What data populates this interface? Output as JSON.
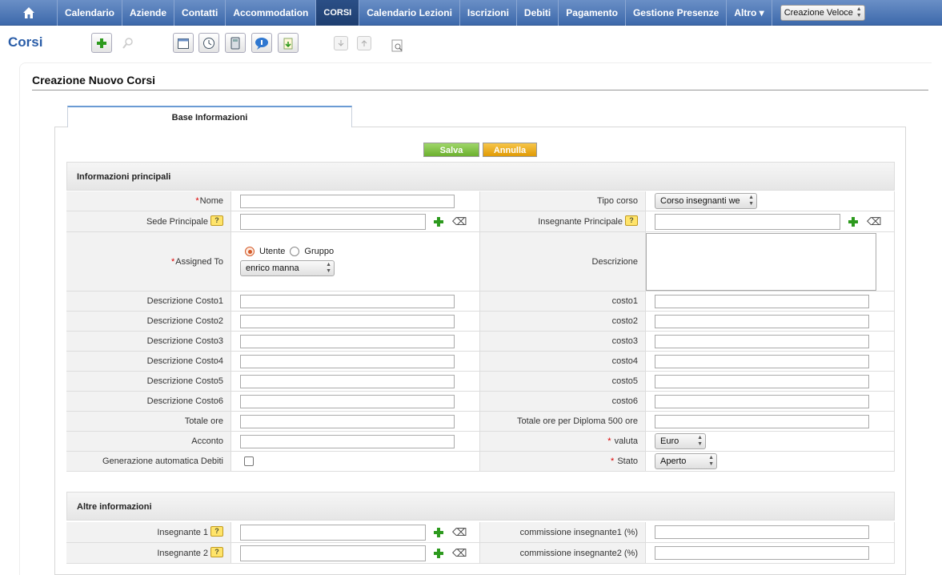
{
  "nav": {
    "items": [
      "Calendario",
      "Aziende",
      "Contatti",
      "Accommodation",
      "CORSI",
      "Calendario Lezioni",
      "Iscrizioni",
      "Debiti",
      "Pagamento",
      "Gestione Presenze",
      "Altro ▾"
    ],
    "active": "CORSI",
    "quick_create": "Creazione Veloce"
  },
  "module_title": "Corsi",
  "icons": {
    "add": "add-icon",
    "search": "search-icon",
    "calendar": "calendar-icon",
    "clock": "clock-icon",
    "calculator": "calculator-icon",
    "chat": "chat-icon",
    "note": "note-icon",
    "import": "import-icon",
    "export": "export-icon",
    "find-duplicates": "find-duplicates-icon"
  },
  "page_title": "Creazione Nuovo Corsi",
  "tab": "Base Informazioni",
  "buttons": {
    "save": "Salva",
    "cancel": "Annulla"
  },
  "sections": {
    "main": "Informazioni principali",
    "other": "Altre informazioni"
  },
  "fields": {
    "nome": "Nome",
    "tipo_corso": "Tipo corso",
    "tipo_corso_value": "Corso insegnanti we",
    "sede": "Sede Principale",
    "insegnante": "Insegnante Principale",
    "assigned": "Assigned To",
    "utente": "Utente",
    "gruppo": "Gruppo",
    "assigned_value": "enrico manna",
    "descrizione": "Descrizione",
    "dc1": "Descrizione Costo1",
    "c1": "costo1",
    "dc2": "Descrizione Costo2",
    "c2": "costo2",
    "dc3": "Descrizione Costo3",
    "c3": "costo3",
    "dc4": "Descrizione Costo4",
    "c4": "costo4",
    "dc5": "Descrizione Costo5",
    "c5": "costo5",
    "dc6": "Descrizione Costo6",
    "c6": "costo6",
    "totale_ore": "Totale ore",
    "totale_diploma": "Totale ore per Diploma 500 ore",
    "acconto": "Acconto",
    "valuta": "valuta",
    "valuta_value": "Euro",
    "gen_debiti": "Generazione automatica Debiti",
    "stato": "Stato",
    "stato_value": "Aperto",
    "ins1": "Insegnante 1",
    "comm1": "commissione insegnante1 (%)",
    "ins2": "Insegnante 2",
    "comm2": "commissione insegnante2 (%)"
  }
}
